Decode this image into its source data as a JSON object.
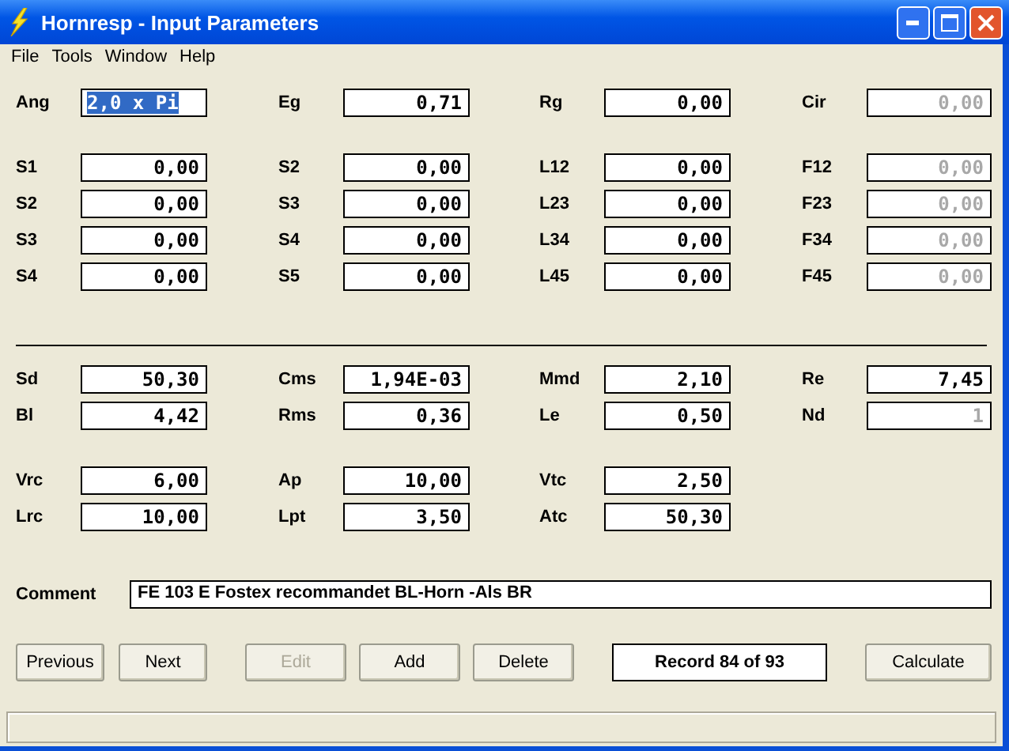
{
  "window": {
    "title": "Hornresp - Input Parameters"
  },
  "menu": [
    "File",
    "Tools",
    "Window",
    "Help"
  ],
  "sections": [
    {
      "kind": "fields",
      "rows": [
        [
          {
            "label": "Ang",
            "value": "2,0 x Pi",
            "disabled": false,
            "selected": true
          },
          {
            "label": "Eg",
            "value": "0,71",
            "disabled": false,
            "selected": false
          },
          {
            "label": "Rg",
            "value": "0,00",
            "disabled": false,
            "selected": false
          },
          {
            "label": "Cir",
            "value": "0,00",
            "disabled": true,
            "selected": false
          }
        ]
      ]
    },
    {
      "kind": "fields",
      "rows": [
        [
          {
            "label": "S1",
            "value": "0,00",
            "disabled": false,
            "selected": false
          },
          {
            "label": "S2",
            "value": "0,00",
            "disabled": false,
            "selected": false
          },
          {
            "label": "L12",
            "value": "0,00",
            "disabled": false,
            "selected": false
          },
          {
            "label": "F12",
            "value": "0,00",
            "disabled": true,
            "selected": false
          }
        ],
        [
          {
            "label": "S2",
            "value": "0,00",
            "disabled": false,
            "selected": false
          },
          {
            "label": "S3",
            "value": "0,00",
            "disabled": false,
            "selected": false
          },
          {
            "label": "L23",
            "value": "0,00",
            "disabled": false,
            "selected": false
          },
          {
            "label": "F23",
            "value": "0,00",
            "disabled": true,
            "selected": false
          }
        ],
        [
          {
            "label": "S3",
            "value": "0,00",
            "disabled": false,
            "selected": false
          },
          {
            "label": "S4",
            "value": "0,00",
            "disabled": false,
            "selected": false
          },
          {
            "label": "L34",
            "value": "0,00",
            "disabled": false,
            "selected": false
          },
          {
            "label": "F34",
            "value": "0,00",
            "disabled": true,
            "selected": false
          }
        ],
        [
          {
            "label": "S4",
            "value": "0,00",
            "disabled": false,
            "selected": false
          },
          {
            "label": "S5",
            "value": "0,00",
            "disabled": false,
            "selected": false
          },
          {
            "label": "L45",
            "value": "0,00",
            "disabled": false,
            "selected": false
          },
          {
            "label": "F45",
            "value": "0,00",
            "disabled": true,
            "selected": false
          }
        ]
      ]
    },
    {
      "kind": "divider"
    },
    {
      "kind": "fields",
      "rows": [
        [
          {
            "label": "Sd",
            "value": "50,30",
            "disabled": false,
            "selected": false
          },
          {
            "label": "Cms",
            "value": "1,94E-03",
            "disabled": false,
            "selected": false
          },
          {
            "label": "Mmd",
            "value": "2,10",
            "disabled": false,
            "selected": false
          },
          {
            "label": "Re",
            "value": "7,45",
            "disabled": false,
            "selected": false
          }
        ],
        [
          {
            "label": "Bl",
            "value": "4,42",
            "disabled": false,
            "selected": false
          },
          {
            "label": "Rms",
            "value": "0,36",
            "disabled": false,
            "selected": false
          },
          {
            "label": "Le",
            "value": "0,50",
            "disabled": false,
            "selected": false
          },
          {
            "label": "Nd",
            "value": "1",
            "disabled": true,
            "selected": false
          }
        ]
      ]
    },
    {
      "kind": "fields",
      "rows": [
        [
          {
            "label": "Vrc",
            "value": "6,00",
            "disabled": false,
            "selected": false
          },
          {
            "label": "Ap",
            "value": "10,00",
            "disabled": false,
            "selected": false
          },
          {
            "label": "Vtc",
            "value": "2,50",
            "disabled": false,
            "selected": false
          }
        ],
        [
          {
            "label": "Lrc",
            "value": "10,00",
            "disabled": false,
            "selected": false
          },
          {
            "label": "Lpt",
            "value": "3,50",
            "disabled": false,
            "selected": false
          },
          {
            "label": "Atc",
            "value": "50,30",
            "disabled": false,
            "selected": false
          }
        ]
      ]
    }
  ],
  "comment": {
    "label": "Comment",
    "value": "FE 103 E Fostex recommandet BL-Horn -Als BR"
  },
  "buttons": [
    {
      "kind": "button",
      "label": "Previous",
      "disabled": false
    },
    {
      "kind": "button",
      "label": "Next",
      "disabled": false
    },
    {
      "kind": "button",
      "label": "Edit",
      "disabled": true
    },
    {
      "kind": "button",
      "label": "Add",
      "disabled": false
    },
    {
      "kind": "button",
      "label": "Delete",
      "disabled": false
    },
    {
      "kind": "record",
      "label": "Record 84 of 93"
    },
    {
      "kind": "button",
      "label": "Calculate",
      "disabled": false
    }
  ]
}
